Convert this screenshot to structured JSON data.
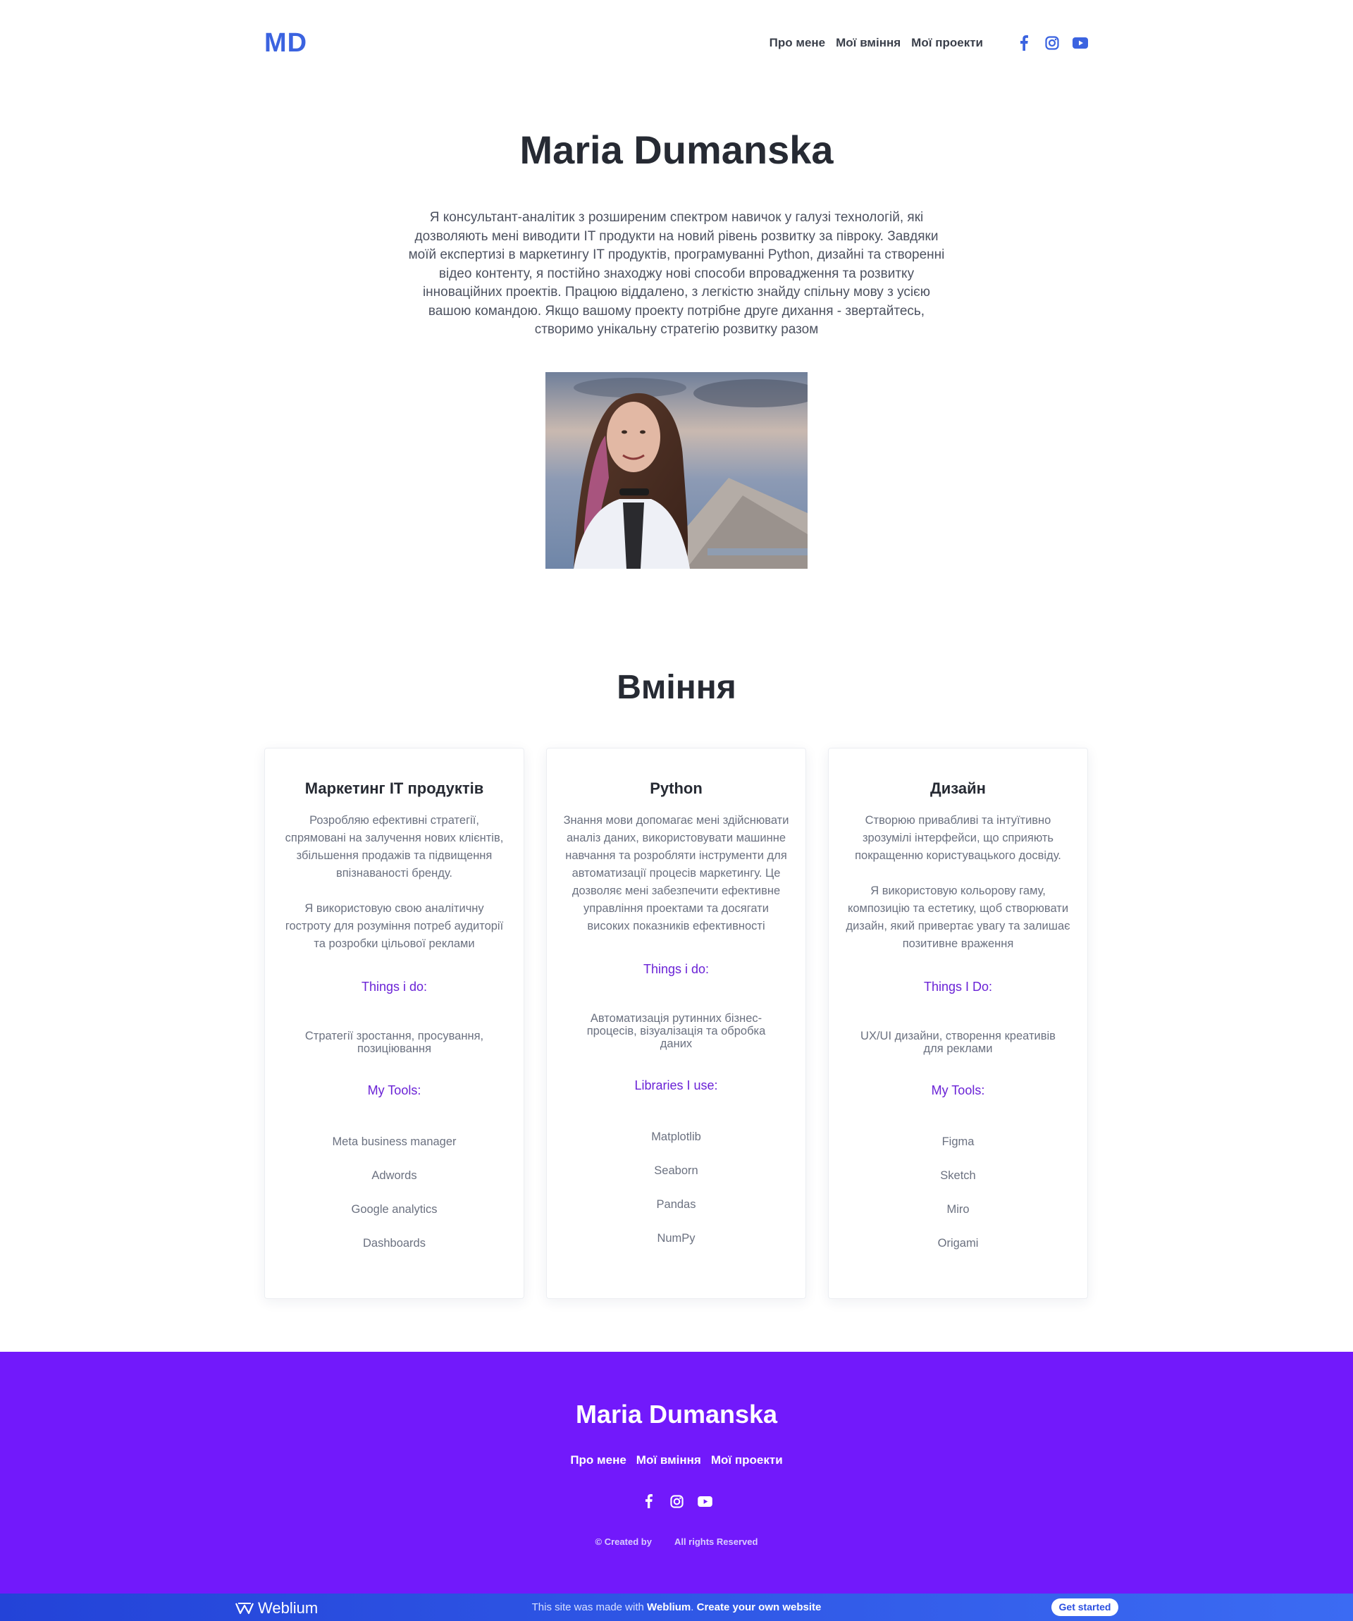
{
  "header": {
    "logo": "MD",
    "nav": [
      "Про мене",
      "Мої вміння",
      "Мої проекти"
    ],
    "social_icons": [
      "facebook-icon",
      "instagram-icon",
      "youtube-icon"
    ],
    "accent_color": "#3b63e0"
  },
  "hero": {
    "title": "Maria Dumanska",
    "text": "Я консультант-аналітик з розширеним спектром навичок у галузі технологій, які дозволяють мені виводити IT продукти на новий рівень розвитку за півроку. Завдяки моїй експертизі в маркетингу IT продуктів, програмуванні Python, дизайні та створенні відео контенту, я постійно знаходжу нові способи впровадження та розвитку інноваційних проектів. Працюю віддалено, з легкістю знайду спільну мову з усією вашою командою. Якщо вашому проекту потрібне друге дихання - звертайтесь, створимо унікальну стратегію розвитку разом"
  },
  "skills": {
    "title": "Вміння",
    "cards": [
      {
        "title": "Маркетинг IT продуктів",
        "desc": "Розробляю ефективні стратегії, спрямовані на залучення нових клієнтів, збільшення продажів та підвищення впізнаваності бренду.\n\nЯ використовую свою аналітичну гостроту для розуміння потреб аудиторії та розробки цільової реклами",
        "things_label": "Things i do:",
        "things": "Стратегії зростання, просування, позиціювання",
        "tools_label": "My Tools:",
        "tools": [
          "Meta business manager",
          "Adwords",
          "Google analytics",
          "Dashboards"
        ]
      },
      {
        "title": "Python",
        "desc": "Знання мови допомагає мені здійснювати аналіз даних, використовувати машинне навчання та розробляти інструменти для автоматизації процесів маркетингу. Це дозволяє мені забезпечити ефективне управління проектами та досягати високих показників ефективності",
        "things_label": "Things i do:",
        "things": "Автоматизація рутинних бізнес-процесів, візуалізація та обробка даних",
        "tools_label": "Libraries I use:",
        "tools": [
          "Matplotlib",
          "Seaborn",
          "Pandas",
          "NumPy"
        ]
      },
      {
        "title": "Дизайн",
        "desc": "Створюю привабливі та інтуїтивно зрозумілі інтерфейси, що сприяють покращенню користувацького досвіду.\n\nЯ використовую кольорову гаму, композицію та естетику, щоб створювати дизайн, який привертає увагу та залишає позитивне враження",
        "things_label": "Things I Do:",
        "things": "UX/UI дизайни, створення креативів для реклами",
        "tools_label": "My Tools:",
        "tools": [
          "Figma",
          "Sketch",
          "Miro",
          "Origami"
        ]
      }
    ]
  },
  "footer": {
    "title": "Maria Dumanska",
    "nav": [
      "Про мене",
      "Мої вміння",
      "Мої проекти"
    ],
    "copyright": "© Created by",
    "rights": "All rights Reserved",
    "bg_color": "#7219fb"
  },
  "weblium": {
    "brand": "Weblium",
    "msg_prefix": "This site was made with",
    "msg_brand": "Weblium",
    "msg_link": "Create your own website",
    "button": "Get started"
  }
}
